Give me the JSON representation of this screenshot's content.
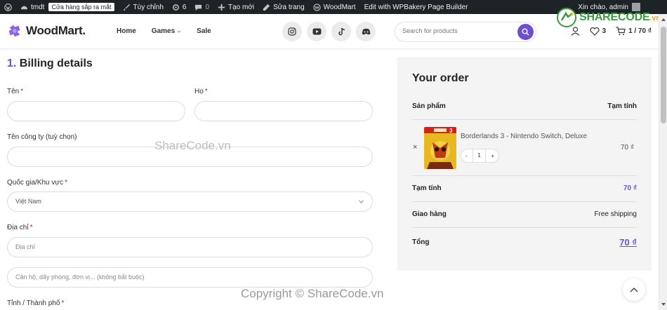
{
  "adminbar": {
    "site_name": "tmdt",
    "badge": "Cửa hàng sắp ra mắt",
    "customize": "Tùy chỉnh",
    "updates_count": "6",
    "comments_count": "0",
    "new_label": "Tạo mới",
    "edit_label": "Sửa trang",
    "theme_label": "WoodMart",
    "builder_label": "Edit with WPBakery Page Builder",
    "greeting": "Xin chào, admin"
  },
  "header": {
    "logo": "WoodMart.",
    "nav": [
      "Home",
      "Games",
      "Sale"
    ],
    "search_placeholder": "Search for products",
    "wishlist_count": "3",
    "cart_summary": "1 / 70 ₫",
    "watermark_logo": "SHARECODE",
    "watermark_tld": ".vn"
  },
  "billing": {
    "step": "1.",
    "title": "Billing details",
    "first_name_label": "Tên",
    "last_name_label": "Họ",
    "company_label": "Tên công ty (tuỳ chọn)",
    "country_label": "Quốc gia/Khu vực",
    "country_value": "Việt Nam",
    "address_label": "Địa chỉ",
    "address_placeholder": "Địa chỉ",
    "address2_placeholder": "Căn hộ, dãy phòng, đơn vị... (không bắt buộc)",
    "city_label": "Tỉnh / Thành phố",
    "required_mark": "*"
  },
  "order": {
    "title": "Your order",
    "col_product": "Sản phẩm",
    "col_subtotal": "Tạm tính",
    "product_name": "Borderlands 3 - Nintendo Switch, Deluxe",
    "product_price": "70 ₫",
    "qty": "1",
    "qty_minus": "-",
    "qty_plus": "+",
    "remove": "×",
    "subtotal_label": "Tạm tính",
    "subtotal_value": "70 ₫",
    "shipping_label": "Giao hàng",
    "shipping_value": "Free shipping",
    "total_label": "Tổng",
    "total_value": "70 ₫"
  },
  "watermark": "ShareCode.vn",
  "copyright": "Copyright © ShareCode.vn",
  "colors": {
    "accent": "#6d4fd2",
    "adminbar": "#1d2327",
    "required": "#e01020"
  }
}
